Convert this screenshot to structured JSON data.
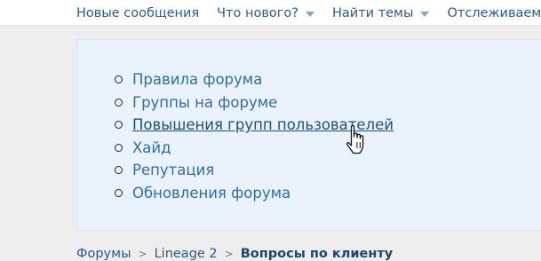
{
  "nav": {
    "items": [
      {
        "label": "Новые сообщения"
      },
      {
        "label": "Что нового?",
        "has_dropdown": true
      },
      {
        "label": "Найти темы",
        "has_dropdown": true
      },
      {
        "label": "Отслеживаемо"
      }
    ]
  },
  "panel": {
    "links": [
      {
        "label": "Правила форума"
      },
      {
        "label": "Группы на форуме"
      },
      {
        "label": "Повышения групп пользователей",
        "hovered": true
      },
      {
        "label": "Хайд"
      },
      {
        "label": "Репутация"
      },
      {
        "label": "Обновления форума"
      }
    ]
  },
  "breadcrumb": {
    "items": [
      "Форумы",
      "Lineage 2",
      "Вопросы по клиенту"
    ],
    "separator": ">"
  },
  "cursor": {
    "icon": "hand-pointer-icon"
  }
}
